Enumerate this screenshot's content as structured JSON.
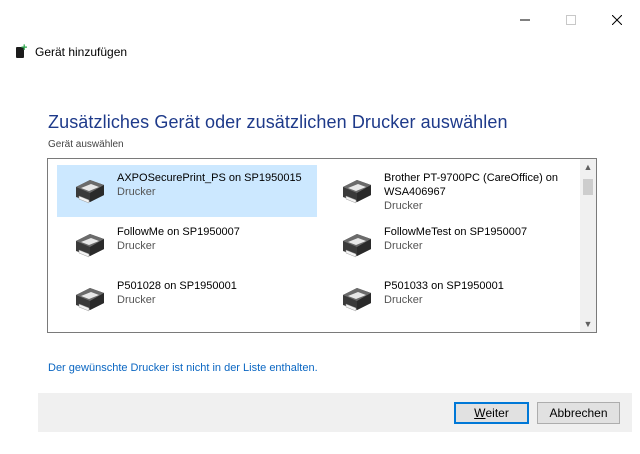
{
  "window": {
    "title": "Gerät hinzufügen",
    "controls": {
      "minimize": "–",
      "maximize": "□",
      "close": "✕"
    }
  },
  "heading": "Zusätzliches Gerät oder zusätzlichen Drucker auswählen",
  "subheading": "Gerät auswählen",
  "devices": [
    {
      "name": "AXPOSecurePrint_PS on SP1950015",
      "type": "Drucker",
      "selected": true
    },
    {
      "name": "Brother PT-9700PC (CareOffice) on WSA406967",
      "type": "Drucker",
      "selected": false
    },
    {
      "name": "FollowMe on SP1950007",
      "type": "Drucker",
      "selected": false
    },
    {
      "name": "FollowMeTest on SP1950007",
      "type": "Drucker",
      "selected": false
    },
    {
      "name": "P501028 on SP1950001",
      "type": "Drucker",
      "selected": false
    },
    {
      "name": "P501033 on SP1950001",
      "type": "Drucker",
      "selected": false
    }
  ],
  "link_text": "Der gewünschte Drucker ist nicht in der Liste enthalten.",
  "buttons": {
    "next_accel": "W",
    "next_rest": "eiter",
    "cancel": "Abbrechen"
  },
  "colors": {
    "heading": "#1e3a8a",
    "link": "#0a66c2",
    "selection": "#cce8ff",
    "footer": "#f0f0f0"
  }
}
